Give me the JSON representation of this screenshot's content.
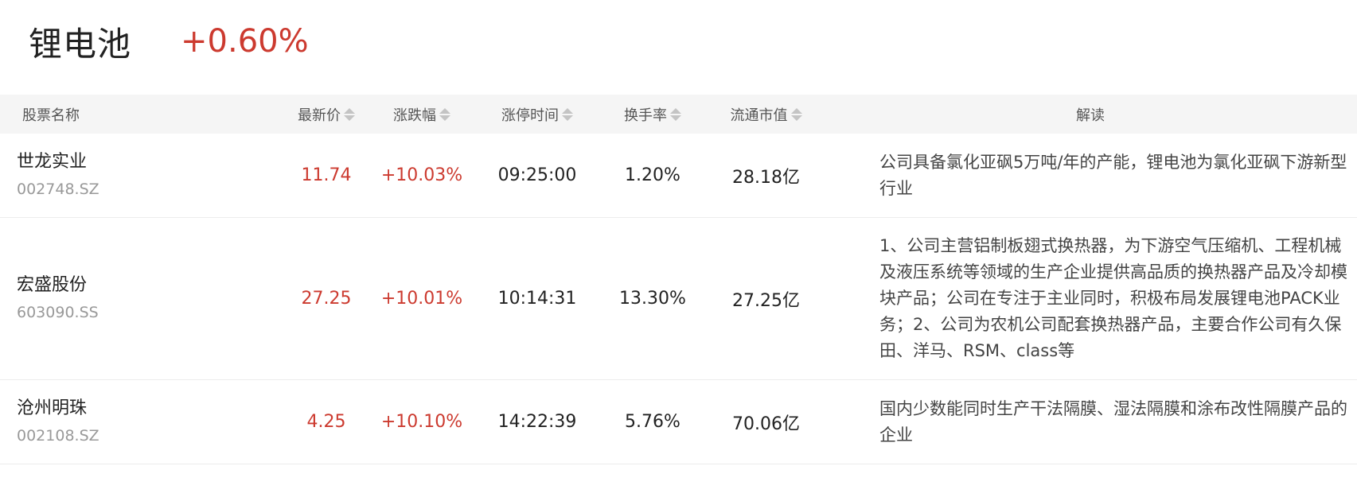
{
  "header": {
    "sector_name": "锂电池",
    "sector_change": "+0.60%"
  },
  "columns": {
    "name": "股票名称",
    "price": "最新价",
    "change": "涨跌幅",
    "limit_time": "涨停时间",
    "turnover": "换手率",
    "market_cap": "流通市值",
    "analysis": "解读"
  },
  "colors": {
    "up": "#cc3a2f",
    "header_bg": "#f5f5f5"
  },
  "rows": [
    {
      "name": "世龙实业",
      "code": "002748.SZ",
      "price": "11.74",
      "change": "+10.03%",
      "limit_time": "09:25:00",
      "turnover": "1.20%",
      "market_cap": "28.18亿",
      "analysis": "公司具备氯化亚砜5万吨/年的产能，锂电池为氯化亚砜下游新型行业"
    },
    {
      "name": "宏盛股份",
      "code": "603090.SS",
      "price": "27.25",
      "change": "+10.01%",
      "limit_time": "10:14:31",
      "turnover": "13.30%",
      "market_cap": "27.25亿",
      "analysis": "1、公司主营铝制板翅式换热器，为下游空气压缩机、工程机械及液压系统等领域的生产企业提供高品质的换热器产品及冷却模块产品；公司在专注于主业同时，积极布局发展锂电池PACK业务；2、公司为农机公司配套换热器产品，主要合作公司有久保田、洋马、RSM、class等"
    },
    {
      "name": "沧州明珠",
      "code": "002108.SZ",
      "price": "4.25",
      "change": "+10.10%",
      "limit_time": "14:22:39",
      "turnover": "5.76%",
      "market_cap": "70.06亿",
      "analysis": "国内少数能同时生产干法隔膜、湿法隔膜和涂布改性隔膜产品的企业"
    }
  ]
}
